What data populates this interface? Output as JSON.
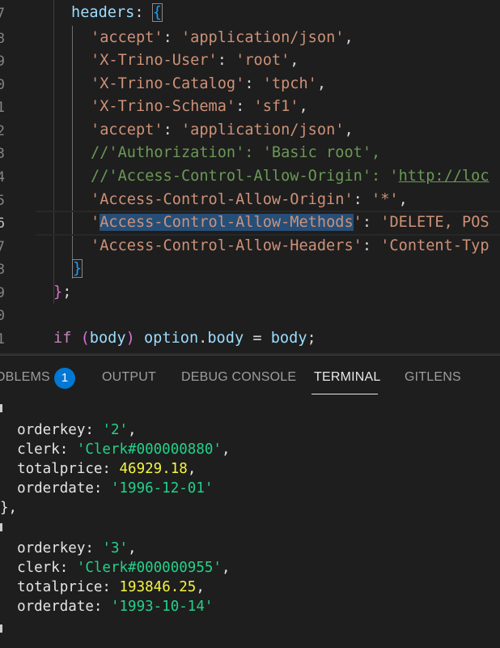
{
  "editor": {
    "line_numbers": [
      "7",
      "8",
      "9",
      "0",
      "1",
      "2",
      "3",
      "4",
      "5",
      "6",
      "7",
      "8",
      "9",
      "0",
      "1"
    ],
    "lines": [
      [
        {
          "t": "headers",
          "c": "k-prop"
        },
        {
          "t": ": ",
          "c": "k-punc"
        },
        {
          "t": "{",
          "c": "k-br3 brk-box"
        }
      ],
      [
        {
          "t": "'accept'",
          "c": "k-str"
        },
        {
          "t": ": ",
          "c": "k-punc"
        },
        {
          "t": "'application/json'",
          "c": "k-str"
        },
        {
          "t": ",",
          "c": "k-punc"
        }
      ],
      [
        {
          "t": "'X-Trino-User'",
          "c": "k-str"
        },
        {
          "t": ": ",
          "c": "k-punc"
        },
        {
          "t": "'root'",
          "c": "k-str"
        },
        {
          "t": ",",
          "c": "k-punc"
        }
      ],
      [
        {
          "t": "'X-Trino-Catalog'",
          "c": "k-str"
        },
        {
          "t": ": ",
          "c": "k-punc"
        },
        {
          "t": "'tpch'",
          "c": "k-str"
        },
        {
          "t": ",",
          "c": "k-punc"
        }
      ],
      [
        {
          "t": "'X-Trino-Schema'",
          "c": "k-str"
        },
        {
          "t": ": ",
          "c": "k-punc"
        },
        {
          "t": "'sf1'",
          "c": "k-str"
        },
        {
          "t": ",",
          "c": "k-punc"
        }
      ],
      [
        {
          "t": "'accept'",
          "c": "k-str"
        },
        {
          "t": ": ",
          "c": "k-punc"
        },
        {
          "t": "'application/json'",
          "c": "k-str"
        },
        {
          "t": ",",
          "c": "k-punc"
        }
      ],
      [
        {
          "t": "//'Authorization': 'Basic root',",
          "c": "k-com"
        }
      ],
      [
        {
          "t": "//'Access-Control-Allow-Origin': '",
          "c": "k-com"
        },
        {
          "t": "http://loc",
          "c": "k-com k-link"
        }
      ],
      [
        {
          "t": "'Access-Control-Allow-Origin'",
          "c": "k-str"
        },
        {
          "t": ": ",
          "c": "k-punc"
        },
        {
          "t": "'*'",
          "c": "k-str"
        },
        {
          "t": ",",
          "c": "k-punc"
        }
      ],
      [
        {
          "t": "'",
          "c": "k-str"
        },
        {
          "t": "Access-Control-Allow-Methods",
          "c": "k-str sel"
        },
        {
          "t": "'",
          "c": "k-str"
        },
        {
          "t": ": ",
          "c": "k-punc"
        },
        {
          "t": "'DELETE, POS",
          "c": "k-str"
        }
      ],
      [
        {
          "t": "'Access-Control-Allow-Headers'",
          "c": "k-str"
        },
        {
          "t": ": ",
          "c": "k-punc"
        },
        {
          "t": "'Content-Typ",
          "c": "k-str"
        }
      ],
      [
        {
          "t": "}",
          "c": "k-br3 brk-box"
        }
      ],
      [
        {
          "t": "}",
          "c": "k-br2"
        },
        {
          "t": ";",
          "c": "k-punc"
        }
      ],
      [],
      [
        {
          "t": "if",
          "c": "k-kw"
        },
        {
          "t": " ",
          "c": "k-punc"
        },
        {
          "t": "(",
          "c": "k-br2"
        },
        {
          "t": "body",
          "c": "k-var"
        },
        {
          "t": ")",
          "c": "k-br2"
        },
        {
          "t": " ",
          "c": "k-punc"
        },
        {
          "t": "option",
          "c": "k-var"
        },
        {
          "t": ".",
          "c": "k-punc"
        },
        {
          "t": "body",
          "c": "k-var"
        },
        {
          "t": " = ",
          "c": "k-punc"
        },
        {
          "t": "body",
          "c": "k-var"
        },
        {
          "t": ";",
          "c": "k-punc"
        }
      ]
    ]
  },
  "panel": {
    "tabs": [
      {
        "label": "OBLEMS",
        "active": false
      },
      {
        "label": "OUTPUT",
        "active": false
      },
      {
        "label": "DEBUG CONSOLE",
        "active": false
      },
      {
        "label": "TERMINAL",
        "active": true
      },
      {
        "label": "GITLENS",
        "active": false
      }
    ],
    "problems_count": "1",
    "accent_color": "#0078d4"
  },
  "terminal": {
    "lines": [
      [
        {
          "t": "",
          "c": ""
        }
      ],
      [
        {
          "t": "  orderkey: ",
          "c": "t-key"
        },
        {
          "t": "'2'",
          "c": "t-str"
        },
        {
          "t": ",",
          "c": "t-key"
        }
      ],
      [
        {
          "t": "  clerk: ",
          "c": "t-key"
        },
        {
          "t": "'Clerk#000000880'",
          "c": "t-str"
        },
        {
          "t": ",",
          "c": "t-key"
        }
      ],
      [
        {
          "t": "  totalprice: ",
          "c": "t-key"
        },
        {
          "t": "46929.18",
          "c": "t-num"
        },
        {
          "t": ",",
          "c": "t-key"
        }
      ],
      [
        {
          "t": "  orderdate: ",
          "c": "t-key"
        },
        {
          "t": "'1996-12-01'",
          "c": "t-str"
        }
      ],
      [
        {
          "t": "},",
          "c": "t-key"
        }
      ],
      [
        {
          "t": "",
          "c": ""
        }
      ],
      [
        {
          "t": "  orderkey: ",
          "c": "t-key"
        },
        {
          "t": "'3'",
          "c": "t-str"
        },
        {
          "t": ",",
          "c": "t-key"
        }
      ],
      [
        {
          "t": "  clerk: ",
          "c": "t-key"
        },
        {
          "t": "'Clerk#000000955'",
          "c": "t-str"
        },
        {
          "t": ",",
          "c": "t-key"
        }
      ],
      [
        {
          "t": "  totalprice: ",
          "c": "t-key"
        },
        {
          "t": "193846.25",
          "c": "t-num"
        },
        {
          "t": ",",
          "c": "t-key"
        }
      ],
      [
        {
          "t": "  orderdate: ",
          "c": "t-key"
        },
        {
          "t": "'1993-10-14'",
          "c": "t-str"
        }
      ]
    ]
  }
}
